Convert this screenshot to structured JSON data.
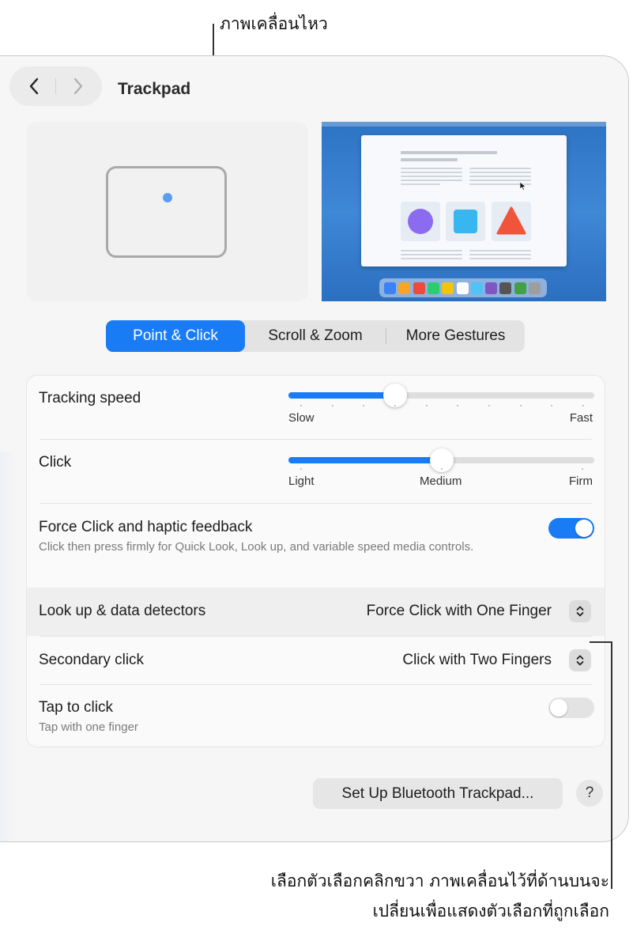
{
  "callouts": {
    "top": "ภาพเคลื่อนไหว",
    "bottom_line1": "เลือกตัวเลือกคลิกขวา ภาพเคลื่อนไว้ที่ด้านบนจะ",
    "bottom_line2": "เปลี่ยนเพื่อแสดงตัวเลือกที่ถูกเลือก"
  },
  "window": {
    "title": "Trackpad",
    "nav": {
      "back_icon": "chevron-left-icon",
      "forward_icon": "chevron-right-icon"
    }
  },
  "tabs": {
    "items": [
      "Point & Click",
      "Scroll & Zoom",
      "More Gestures"
    ],
    "selected": "Point & Click"
  },
  "settings": {
    "tracking_speed": {
      "label": "Tracking speed",
      "value": 0.35,
      "min_label": "Slow",
      "max_label": "Fast"
    },
    "click": {
      "label": "Click",
      "value": 0.5,
      "min_label": "Light",
      "mid_label": "Medium",
      "max_label": "Firm"
    },
    "force_click": {
      "label": "Force Click and haptic feedback",
      "description": "Click then press firmly for Quick Look, Look up, and variable speed media controls.",
      "enabled": true
    },
    "look_up": {
      "label": "Look up & data detectors",
      "value": "Force Click with One Finger"
    },
    "secondary_click": {
      "label": "Secondary click",
      "value": "Click with Two Fingers"
    },
    "tap_to_click": {
      "label": "Tap to click",
      "description": "Tap with one finger",
      "enabled": false
    }
  },
  "buttons": {
    "setup": "Set Up Bluetooth Trackpad...",
    "help": "?"
  },
  "colors": {
    "accent": "#1a7cf5",
    "toggle_off": "#e3e3e3",
    "window_bg": "#f6f6f6"
  },
  "dock_colors": [
    "#3b82f6",
    "#f5a623",
    "#e74c3c",
    "#2ecc71",
    "#f1c40f",
    "#ffffff",
    "#4fc3f7",
    "#7e57c2",
    "#555555",
    "#43a047",
    "#9e9e9e"
  ]
}
